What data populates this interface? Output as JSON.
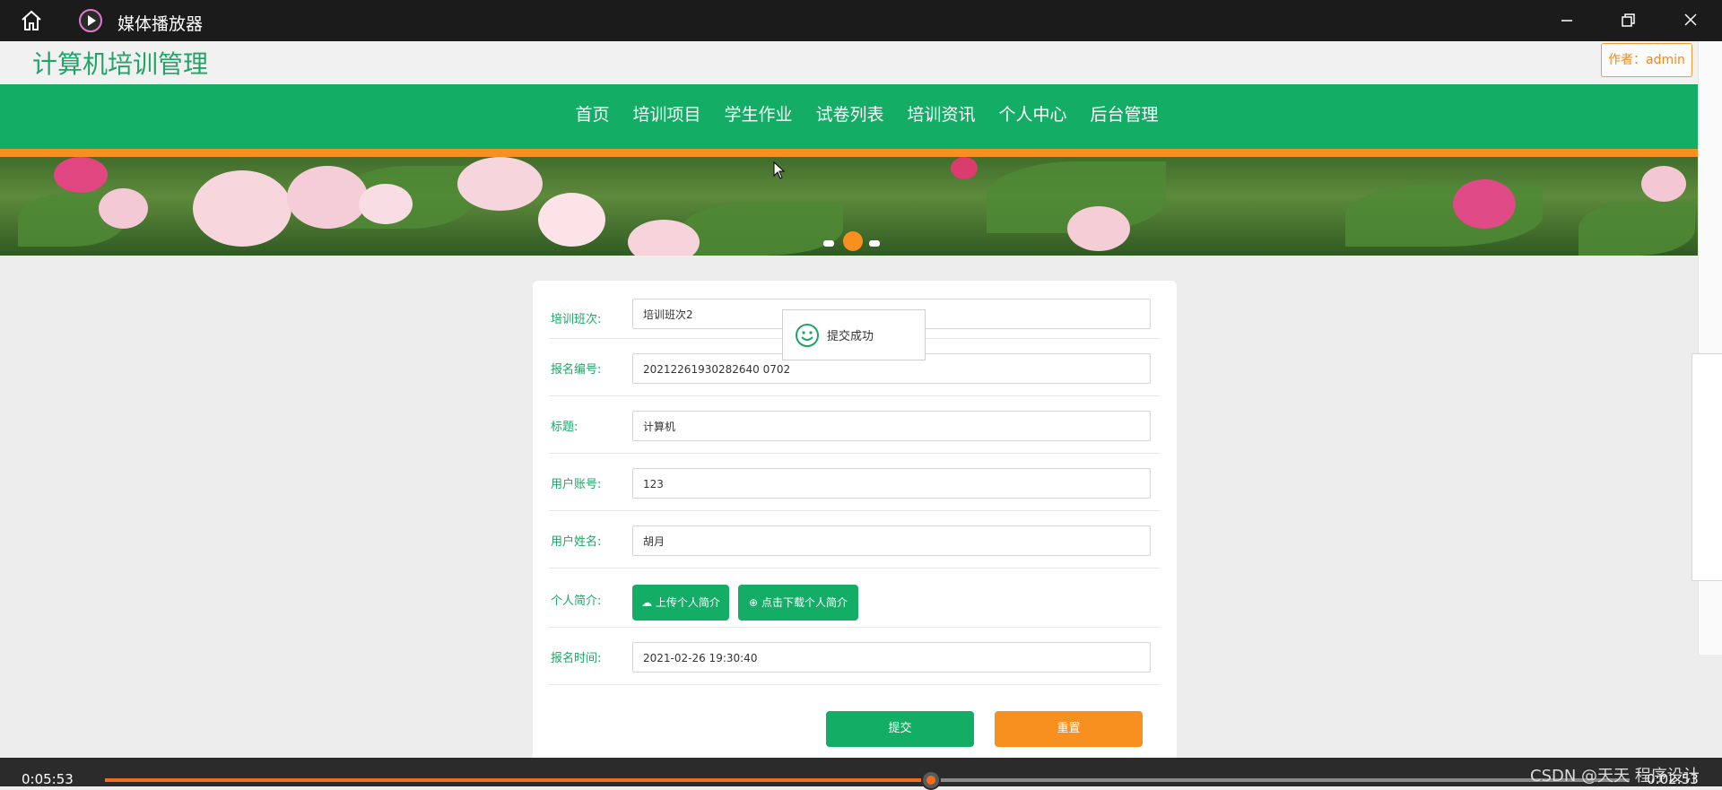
{
  "window": {
    "title": "媒体播放器",
    "controls": [
      "minimize",
      "restore",
      "close"
    ]
  },
  "site": {
    "title": "计算机培训管理",
    "author_badge": "作者：admin"
  },
  "nav": {
    "items": [
      "首页",
      "培训项目",
      "学生作业",
      "试卷列表",
      "培训资讯",
      "个人中心",
      "后台管理"
    ]
  },
  "banner": {
    "slides_total": 3,
    "active_slide": 2
  },
  "form": {
    "fields": [
      {
        "label": "培训班次:",
        "value": "培训班次2"
      },
      {
        "label": "报名编号:",
        "value": "20212261930282640 0702"
      },
      {
        "label": "标题:",
        "value": "计算机"
      },
      {
        "label": "用户账号:",
        "value": "123"
      },
      {
        "label": "用户姓名:",
        "value": "胡月"
      }
    ],
    "resume": {
      "label": "个人简介:",
      "upload_label": "上传个人简介",
      "download_label": "点击下载个人简介"
    },
    "date_field": {
      "label": "报名时间:",
      "value": "2021-02-26 19:30:40"
    },
    "submit_label": "提交",
    "reset_label": "重置"
  },
  "toast": {
    "message": "提交成功"
  },
  "player": {
    "time_current": "0:05:53",
    "time_remaining": "0:02:53",
    "progress_percent": 54.2,
    "watermark": "CSDN @天天 程序设计"
  },
  "colors": {
    "brand_green": "#13ad66",
    "accent_orange": "#f7901e",
    "progress_orange": "#f46b1d"
  }
}
